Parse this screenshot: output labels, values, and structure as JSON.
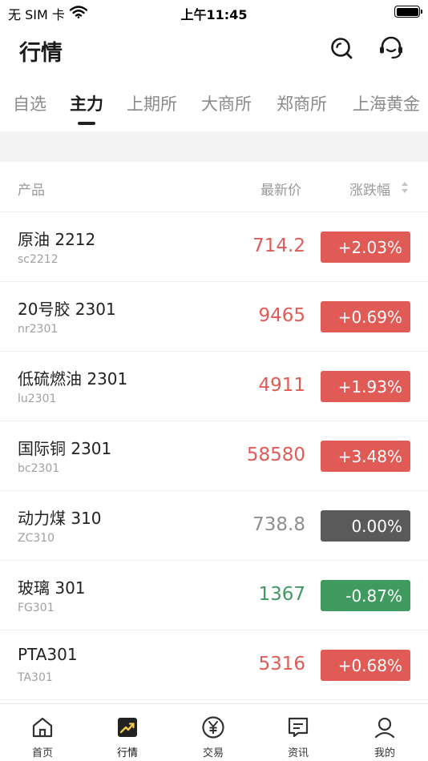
{
  "status_bar": {
    "carrier": "无 SIM 卡",
    "time": "上午11:45"
  },
  "header": {
    "title": "行情"
  },
  "tabs": [
    {
      "label": "自选",
      "active": false
    },
    {
      "label": "主力",
      "active": true
    },
    {
      "label": "上期所",
      "active": false
    },
    {
      "label": "大商所",
      "active": false
    },
    {
      "label": "郑商所",
      "active": false
    },
    {
      "label": "上海黄金",
      "active": false
    }
  ],
  "list_header": {
    "product": "产品",
    "price": "最新价",
    "change": "涨跌幅"
  },
  "rows": [
    {
      "name": "原油 2212",
      "code": "sc2212",
      "price": "714.2",
      "change": "+2.03%",
      "trend": "up"
    },
    {
      "name": "20号胶 2301",
      "code": "nr2301",
      "price": "9465",
      "change": "+0.69%",
      "trend": "up"
    },
    {
      "name": "低硫燃油 2301",
      "code": "lu2301",
      "price": "4911",
      "change": "+1.93%",
      "trend": "up"
    },
    {
      "name": "国际铜 2301",
      "code": "bc2301",
      "price": "58580",
      "change": "+3.48%",
      "trend": "up"
    },
    {
      "name": "动力煤 310",
      "code": "ZC310",
      "price": "738.8",
      "change": "0.00%",
      "trend": "flat"
    },
    {
      "name": "玻璃 301",
      "code": "FG301",
      "price": "1367",
      "change": "-0.87%",
      "trend": "down"
    },
    {
      "name": "PTA301",
      "code": "TA301",
      "price": "5316",
      "change": "+0.68%",
      "trend": "up"
    }
  ],
  "colors": {
    "up": "#e15b56",
    "down": "#3e9a5f",
    "flat_badge": "#5a5a5a",
    "flat_text": "#8f8f8f"
  },
  "tabbar": [
    {
      "label": "首页",
      "icon": "home-icon"
    },
    {
      "label": "行情",
      "icon": "market-chart-icon",
      "active": true
    },
    {
      "label": "交易",
      "icon": "yuan-icon"
    },
    {
      "label": "资讯",
      "icon": "news-icon"
    },
    {
      "label": "我的",
      "icon": "user-icon"
    }
  ]
}
